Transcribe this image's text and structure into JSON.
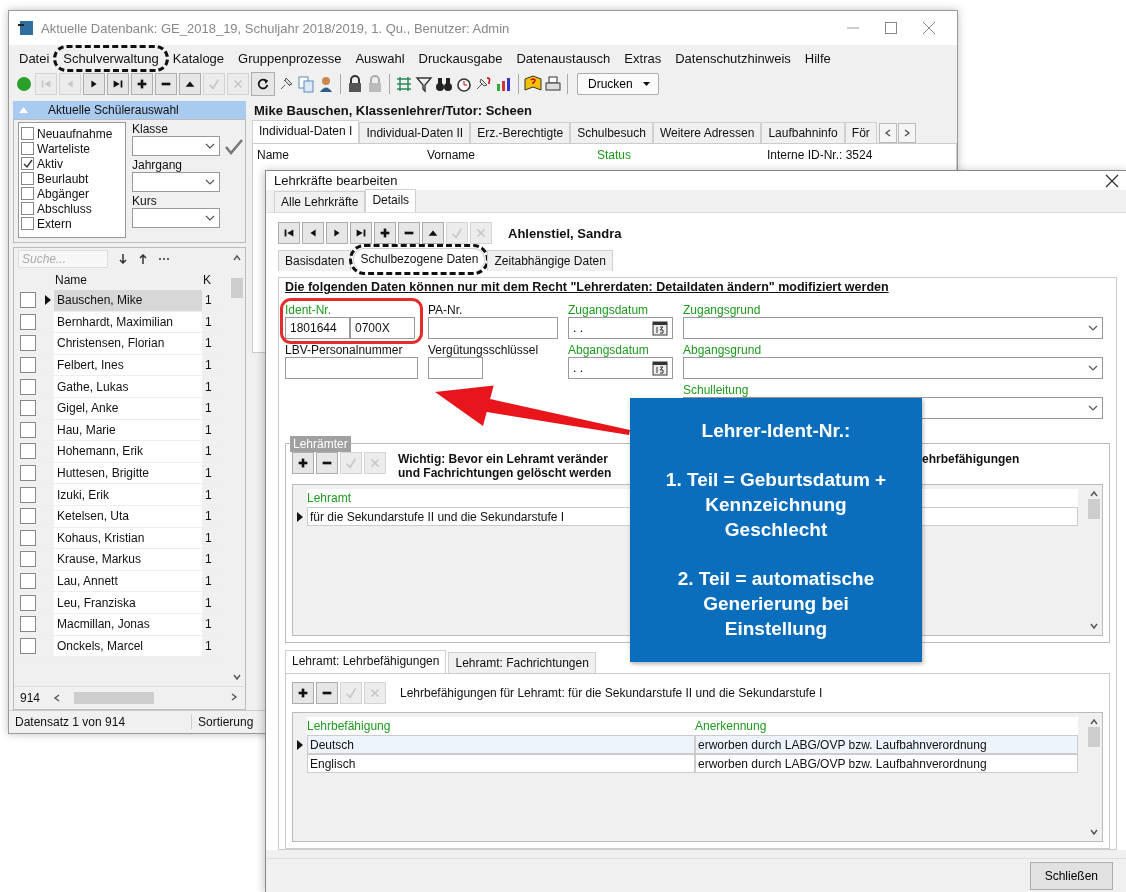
{
  "main_window": {
    "title": "Aktuelle Datenbank: GE_2018_19, Schuljahr 2018/2019, 1. Qu., Benutzer: Admin",
    "menu": [
      {
        "label": "Datei",
        "circled": false
      },
      {
        "label": "Schulverwaltung",
        "circled": true
      },
      {
        "label": "Kataloge",
        "circled": false
      },
      {
        "label": "Gruppenprozesse",
        "circled": false
      },
      {
        "label": "Auswahl",
        "circled": false
      },
      {
        "label": "Druckausgabe",
        "circled": false
      },
      {
        "label": "Datenaustausch",
        "circled": false
      },
      {
        "label": "Extras",
        "circled": false
      },
      {
        "label": "Datenschutzhinweis",
        "circled": false
      },
      {
        "label": "Hilfe",
        "circled": false
      }
    ],
    "toolbar": {
      "nav": [
        {
          "kind": "first",
          "disabled": true
        },
        {
          "kind": "prev",
          "disabled": true
        },
        {
          "kind": "next",
          "disabled": false
        },
        {
          "kind": "last",
          "disabled": false
        },
        {
          "kind": "add",
          "disabled": false
        },
        {
          "kind": "remove",
          "disabled": false
        },
        {
          "kind": "up",
          "disabled": false
        },
        {
          "kind": "ok",
          "disabled": true
        },
        {
          "kind": "cancel",
          "disabled": true
        }
      ],
      "print_button": "Drucken"
    },
    "selection_panel": {
      "title": "Aktuelle Schülerauswahl",
      "filters": [
        {
          "label": "Neuaufnahme",
          "checked": false
        },
        {
          "label": "Warteliste",
          "checked": false
        },
        {
          "label": "Aktiv",
          "checked": true
        },
        {
          "label": "Beurlaubt",
          "checked": false
        },
        {
          "label": "Abgänger",
          "checked": false
        },
        {
          "label": "Abschluss",
          "checked": false
        },
        {
          "label": "Extern",
          "checked": false
        }
      ],
      "fields": [
        "Klasse",
        "Jahrgang",
        "Kurs"
      ]
    },
    "student_list": {
      "search_placeholder": "Suche...",
      "columns": [
        "Name",
        "K"
      ],
      "rows": [
        {
          "name": "Bauschen, Mike",
          "column_2": "1",
          "selected": true
        },
        {
          "name": "Bernhardt, Maximilian",
          "column_2": "1",
          "selected": false
        },
        {
          "name": "Christensen, Florian",
          "column_2": "1",
          "selected": false
        },
        {
          "name": "Felbert, Ines",
          "column_2": "1",
          "selected": false
        },
        {
          "name": "Gathe, Lukas",
          "column_2": "1",
          "selected": false
        },
        {
          "name": "Gigel, Anke",
          "column_2": "1",
          "selected": false
        },
        {
          "name": "Hau, Marie",
          "column_2": "1",
          "selected": false
        },
        {
          "name": "Hohemann, Erik",
          "column_2": "1",
          "selected": false
        },
        {
          "name": "Huttesen, Brigitte",
          "column_2": "1",
          "selected": false
        },
        {
          "name": "Izuki, Erik",
          "column_2": "1",
          "selected": false
        },
        {
          "name": "Ketelsen, Uta",
          "column_2": "1",
          "selected": false
        },
        {
          "name": "Kohaus, Kristian",
          "column_2": "1",
          "selected": false
        },
        {
          "name": "Krause, Markus",
          "column_2": "1",
          "selected": false
        },
        {
          "name": "Lau, Annett",
          "column_2": "1",
          "selected": false
        },
        {
          "name": "Leu, Franziska",
          "column_2": "1",
          "selected": false
        },
        {
          "name": "Macmillan, Jonas",
          "column_2": "1",
          "selected": false
        },
        {
          "name": "Onckels, Marcel",
          "column_2": "1",
          "selected": false
        }
      ],
      "count": "914"
    },
    "status_bar": [
      "Datensatz 1 von 914",
      "Sortierung"
    ],
    "record": {
      "heading": "Mike Bauschen, Klassenlehrer/Tutor: Scheen",
      "tabs": [
        {
          "label": "Individual-Daten I",
          "selected": true
        },
        {
          "label": "Individual-Daten II",
          "selected": false
        },
        {
          "label": "Erz.-Berechtigte",
          "selected": false
        },
        {
          "label": "Schulbesuch",
          "selected": false
        },
        {
          "label": "Weitere Adressen",
          "selected": false
        },
        {
          "label": "Laufbahninfo",
          "selected": false
        },
        {
          "label": "För",
          "selected": false
        }
      ],
      "fields": [
        {
          "label": "Name",
          "required": false
        },
        {
          "label": "Vorname",
          "required": false
        },
        {
          "label": "Status",
          "required": true
        }
      ],
      "internal_id": "Interne ID-Nr.: 3524"
    }
  },
  "dialog": {
    "title": "Lehrkräfte bearbeiten",
    "tabs": [
      {
        "label": "Alle Lehrkräfte",
        "selected": false
      },
      {
        "label": "Details",
        "selected": true
      }
    ],
    "nav": [
      {
        "kind": "first",
        "disabled": false
      },
      {
        "kind": "prev",
        "disabled": false
      },
      {
        "kind": "next",
        "disabled": false
      },
      {
        "kind": "last",
        "disabled": false
      },
      {
        "kind": "add",
        "disabled": false
      },
      {
        "kind": "remove",
        "disabled": false
      },
      {
        "kind": "up",
        "disabled": false
      },
      {
        "kind": "ok",
        "disabled": true
      },
      {
        "kind": "cancel",
        "disabled": true
      }
    ],
    "teacher_name": "Ahlenstiel, Sandra",
    "subtabs": [
      {
        "label": "Basisdaten",
        "selected": false,
        "circled": false
      },
      {
        "label": "Schulbezogene Daten",
        "selected": true,
        "circled": true
      },
      {
        "label": "Zeitabhängige Daten",
        "selected": false,
        "circled": false
      }
    ],
    "notice": "Die folgenden Daten können nur mit dem Recht \"Lehrerdaten: Detaildaten ändern\" modifiziert werden",
    "fields": [
      {
        "label": "Ident-Nr.",
        "required": true,
        "kind": "split",
        "values": [
          "1801644",
          "0700X"
        ],
        "highlighted": true
      },
      {
        "label": "PA-Nr.",
        "required": false,
        "kind": "text"
      },
      {
        "label": "Zugangsdatum",
        "required": true,
        "kind": "date",
        "value": ". ."
      },
      {
        "label": "Zugangsgrund",
        "required": true,
        "kind": "select"
      },
      {
        "label": "LBV-Personalnummer",
        "required": false,
        "kind": "text"
      },
      {
        "label": "Vergütungsschlüssel",
        "required": false,
        "kind": "short"
      },
      {
        "label": "Abgangsdatum",
        "required": true,
        "kind": "date",
        "value": ". ."
      },
      {
        "label": "Abgangsgrund",
        "required": true,
        "kind": "select"
      },
      {
        "label": "Schulleitung",
        "required": true,
        "kind": "select"
      }
    ],
    "offices": {
      "legend": "Lehrämter",
      "nav": [
        {
          "kind": "add",
          "disabled": false
        },
        {
          "kind": "remove",
          "disabled": false
        },
        {
          "kind": "ok",
          "disabled": true
        },
        {
          "kind": "cancel",
          "disabled": true
        }
      ],
      "notice_lines": [
        "Wichtig: Bevor ein Lehramt veränder",
        "und Fachrichtungen gelöscht werden"
      ],
      "notice_tail": "ehrbefähigungen",
      "column": "Lehramt",
      "rows": [
        {
          "text": "für die Sekundarstufe II und die Sekundarstufe I",
          "selected": true
        }
      ]
    },
    "lower_tabs": [
      {
        "label": "Lehramt: Lehrbefähigungen",
        "selected": true
      },
      {
        "label": "Lehramt: Fachrichtungen",
        "selected": false
      }
    ],
    "qualifications": {
      "nav": [
        {
          "kind": "add",
          "disabled": false
        },
        {
          "kind": "remove",
          "disabled": false
        },
        {
          "kind": "ok",
          "disabled": true
        },
        {
          "kind": "cancel",
          "disabled": true
        }
      ],
      "caption": "Lehrbefähigungen für Lehramt:  für die Sekundarstufe II und die Sekundarstufe I",
      "columns": [
        "Lehrbefähigung",
        "Anerkennung"
      ],
      "rows": [
        {
          "cells": [
            "Deutsch",
            "erworben durch LABG/OVP bzw. Laufbahnverordnung"
          ],
          "selected": true
        },
        {
          "cells": [
            "Englisch",
            "erworben durch LABG/OVP bzw. Laufbahnverordnung"
          ],
          "selected": false
        }
      ]
    },
    "close_button": "Schließen"
  },
  "callout": {
    "paragraphs": [
      "Lehrer-Ident-Nr.:",
      "1. Teil = Geburtsdatum + Kennzeichnung Geschlecht",
      "2. Teil = automatische Generierung bei Einstellung"
    ]
  }
}
